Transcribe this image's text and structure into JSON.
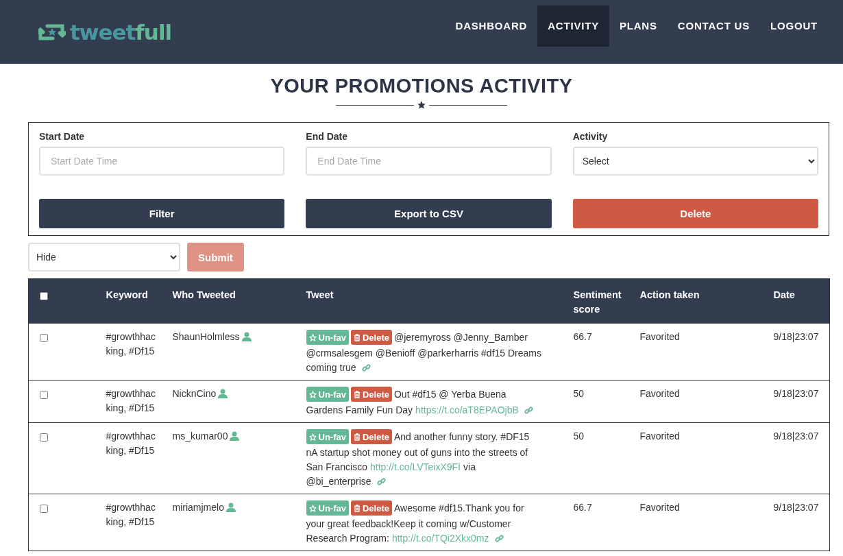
{
  "logo": {
    "text": "tweet",
    "accent": "full"
  },
  "nav": [
    {
      "label": "DASHBOARD",
      "selected": false
    },
    {
      "label": "ACTIVITY",
      "selected": true
    },
    {
      "label": "PLANS",
      "selected": false
    },
    {
      "label": "CONTACT US",
      "selected": false
    },
    {
      "label": "LOGOUT",
      "selected": false
    }
  ],
  "page_title": "YOUR PROMOTIONS ACTIVITY",
  "filters": {
    "fields": [
      {
        "kind": "input",
        "label": "Start Date",
        "placeholder": "Start Date Time"
      },
      {
        "kind": "input",
        "label": "End Date",
        "placeholder": "End Date Time"
      },
      {
        "kind": "select",
        "label": "Activity",
        "value": "Select"
      }
    ],
    "buttons": [
      {
        "label": "Filter",
        "kind": "primary"
      },
      {
        "label": "Export to CSV",
        "kind": "primary"
      },
      {
        "label": "Delete",
        "kind": "danger"
      }
    ]
  },
  "bulk": {
    "value": "Hide",
    "submit": {
      "label": "Submit",
      "disabled": true
    }
  },
  "table": {
    "select_all": {
      "checked": false
    },
    "columns": [
      "Keyword",
      "Who Tweeted",
      "Tweet",
      "Sentiment score",
      "Action taken",
      "Date"
    ],
    "rows": [
      {
        "checked": false,
        "keyword": "#growthhacking, #Df15",
        "who": "ShaunHolmless",
        "unfav": "Un-fav",
        "delete": "Delete",
        "tweet": [
          [
            {
              "kind": "text",
              "text": "@jeremyross @Jenny_Bamber"
            }
          ],
          [
            {
              "kind": "text",
              "text": "@crmsalesgem @Benioff @parkerharris #df15 Dreams"
            }
          ],
          [
            {
              "kind": "text",
              "text": "coming true"
            }
          ]
        ],
        "score": "66.7",
        "action": "Favorited",
        "date": "9/18|23:07"
      },
      {
        "checked": false,
        "keyword": "#growthhacking, #Df15",
        "who": "NicknCino",
        "unfav": "Un-fav",
        "delete": "Delete",
        "tweet": [
          [
            {
              "kind": "text",
              "text": "Out #df15 @ Yerba Buena"
            }
          ],
          [
            {
              "kind": "text",
              "text": "Gardens Family Fun Day"
            },
            {
              "kind": "link",
              "text": "https://t.co/aT8EPAOjbB"
            }
          ]
        ],
        "score": "50",
        "action": "Favorited",
        "date": "9/18|23:07"
      },
      {
        "checked": false,
        "keyword": "#growthhacking, #Df15",
        "who": "ms_kumar00",
        "unfav": "Un-fav",
        "delete": "Delete",
        "tweet": [
          [
            {
              "kind": "text",
              "text": "And another funny story. #DF15"
            }
          ],
          [
            {
              "kind": "text",
              "text": "nA startup shot money out of guns into the streets of"
            }
          ],
          [
            {
              "kind": "text",
              "text": "San Francisco"
            },
            {
              "kind": "link",
              "text": "http://t.co/LVTeixX9FI"
            },
            {
              "kind": "text",
              "text": "via"
            }
          ],
          [
            {
              "kind": "text",
              "text": "@bi_enterprise"
            }
          ]
        ],
        "score": "50",
        "action": "Favorited",
        "date": "9/18|23:07"
      },
      {
        "checked": false,
        "keyword": "#growthhacking, #Df15",
        "who": "miriamjmelo",
        "unfav": "Un-fav",
        "delete": "Delete",
        "tweet": [
          [
            {
              "kind": "text",
              "text": "Awesome #df15.Thank you for"
            }
          ],
          [
            {
              "kind": "text",
              "text": "your great feedback!Keep it coming w/Customer"
            }
          ],
          [
            {
              "kind": "text",
              "text": "Research Program:"
            },
            {
              "kind": "link",
              "text": "http://t.co/TQi2Xkx0mz"
            }
          ]
        ],
        "score": "66.7",
        "action": "Favorited",
        "date": "9/18|23:07"
      }
    ]
  }
}
